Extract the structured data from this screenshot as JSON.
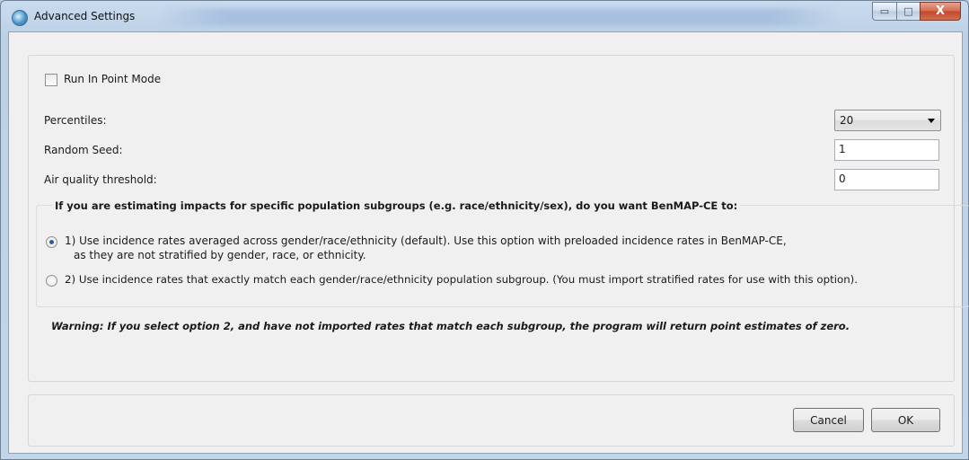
{
  "window": {
    "title": "Advanced Settings",
    "controls": {
      "minimize": "▭",
      "maximize": "□",
      "close": "X"
    }
  },
  "run_point_mode": {
    "label": "Run In Point Mode",
    "checked": false
  },
  "percentiles": {
    "label": "Percentiles:",
    "value": "20"
  },
  "random_seed": {
    "label": "Random Seed:",
    "value": "1"
  },
  "air_quality_threshold": {
    "label": "Air quality threshold:",
    "value": "0"
  },
  "subgroups": {
    "question": "If you are estimating impacts for specific population subgroups (e.g. race/ethnicity/sex), do you want BenMAP-CE to:",
    "option1_line1": "1)  Use incidence rates averaged across gender/race/ethnicity (default).  Use this option with preloaded incidence rates in BenMAP-CE,",
    "option1_line2": "as they are not stratified by gender, race, or ethnicity.",
    "option2": "2) Use incidence rates that exactly match each gender/race/ethnicity population subgroup. (You must import stratified rates for use with this option).",
    "selected": 1
  },
  "warning": "Warning: If you select option 2, and have not imported rates that match each subgroup, the program will return point estimates of zero.",
  "buttons": {
    "cancel": "Cancel",
    "ok": "OK"
  },
  "colors": {
    "title_bar": "#c3d5e9",
    "client": "#f0f0f0",
    "close_button": "#c94a2e",
    "radio_dot": "#2d5c94"
  }
}
